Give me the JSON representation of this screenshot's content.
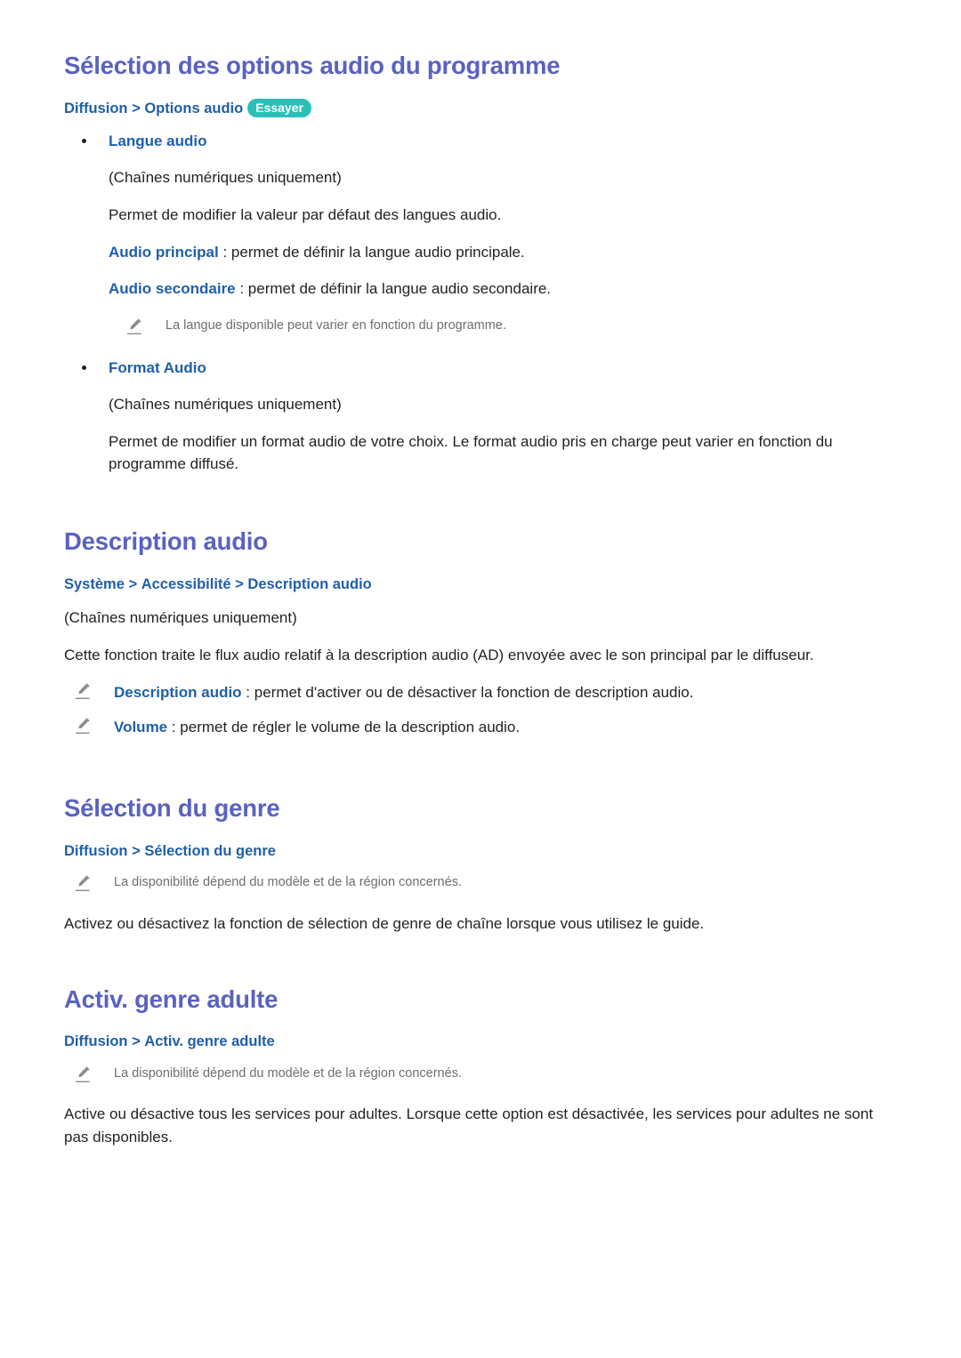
{
  "sections": [
    {
      "id": "selection-options-audio",
      "title": "Sélection des options audio du programme",
      "breadcrumb": {
        "crumbs": [
          "Diffusion",
          "Options audio"
        ],
        "separator": " > ",
        "badge": "Essayer"
      },
      "bullets": [
        {
          "title": "Langue audio",
          "paragraphs": [
            {
              "text": "(Chaînes numériques uniquement)"
            },
            {
              "text": "Permet de modifier la valeur par défaut des langues audio."
            },
            {
              "kw": "Audio principal",
              "text": " : permet de définir la langue audio principale."
            },
            {
              "kw": "Audio secondaire",
              "text": " : permet de définir la langue audio secondaire."
            }
          ],
          "notes": [
            {
              "icon": "pencil-icon",
              "text": "La langue disponible peut varier en fonction du programme."
            }
          ]
        },
        {
          "title": "Format Audio",
          "paragraphs": [
            {
              "text": "(Chaînes numériques uniquement)"
            },
            {
              "text": "Permet de modifier un format audio de votre choix. Le format audio pris en charge peut varier en fonction du programme diffusé."
            }
          ],
          "notes": []
        }
      ]
    },
    {
      "id": "description-audio",
      "title": "Description audio",
      "breadcrumb": {
        "crumbs": [
          "Système",
          "Accessibilité",
          "Description audio"
        ],
        "separator": " > ",
        "badge": null
      },
      "paragraphs": [
        {
          "text": "(Chaînes numériques uniquement)"
        },
        {
          "text": "Cette fonction traite le flux audio relatif à la description audio (AD) envoyée avec le son principal par le diffuseur."
        }
      ],
      "notes": [
        {
          "icon": "pencil-icon",
          "kw": "Description audio",
          "text": " : permet d'activer ou de désactiver la fonction de description audio.",
          "size": "large"
        },
        {
          "icon": "pencil-icon",
          "kw": "Volume",
          "text": " : permet de régler le volume de la description audio.",
          "size": "large"
        }
      ]
    },
    {
      "id": "selection-du-genre",
      "title": "Sélection du genre",
      "breadcrumb": {
        "crumbs": [
          "Diffusion",
          "Sélection du genre"
        ],
        "separator": " > ",
        "badge": null
      },
      "notes": [
        {
          "icon": "pencil-icon",
          "text": "La disponibilité dépend du modèle et de la région concernés.",
          "size": "small"
        }
      ],
      "paragraphs_after": [
        {
          "text": "Activez ou désactivez la fonction de sélection de genre de chaîne lorsque vous utilisez le guide."
        }
      ]
    },
    {
      "id": "activ-genre-adulte",
      "title": "Activ. genre adulte",
      "breadcrumb": {
        "crumbs": [
          "Diffusion",
          "Activ. genre adulte"
        ],
        "separator": " > ",
        "badge": null
      },
      "notes": [
        {
          "icon": "pencil-icon",
          "text": "La disponibilité dépend du modèle et de la région concernés.",
          "size": "small"
        }
      ],
      "paragraphs_after": [
        {
          "text": "Active ou désactive tous les services pour adultes. Lorsque cette option est désactivée, les services pour adultes ne sont pas disponibles."
        }
      ]
    }
  ],
  "colors": {
    "heading": "#5a62c0",
    "breadcrumb": "#1f5fa8",
    "keyword": "#1f5fa8",
    "badge_bg": "#2bbfb8",
    "badge_text": "#ffffff",
    "body_text": "#231f20",
    "note_text": "#6d6e71",
    "page_bg": "#ffffff"
  }
}
